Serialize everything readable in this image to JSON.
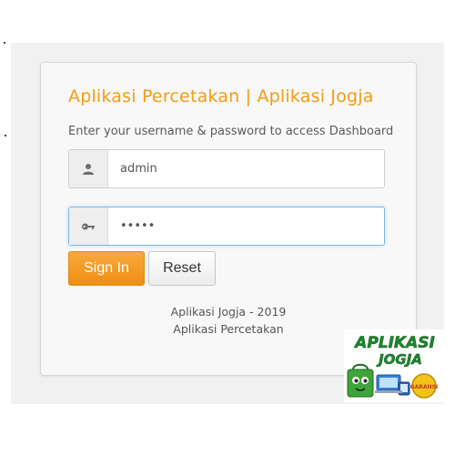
{
  "login": {
    "title": "Aplikasi Percetakan | Aplikasi Jogja",
    "subtitle": "Enter your username & password to access Dashboard",
    "username": {
      "value": "admin",
      "icon": "user-icon"
    },
    "password": {
      "value": "•••••",
      "icon": "key-icon"
    },
    "buttons": {
      "signin": "Sign In",
      "reset": "Reset"
    },
    "footer": {
      "line1": "Aplikasi Jogja - 2019",
      "line2": "Aplikasi Percetakan"
    }
  },
  "logo": {
    "line1": "APLIKASI",
    "line2": "JOGJA",
    "badge": "GARANSI"
  },
  "colors": {
    "accent": "#f39c12",
    "focus": "#7fb6dd",
    "logo_text": "#1c8a2c",
    "logo_face": "#3ea53a"
  }
}
